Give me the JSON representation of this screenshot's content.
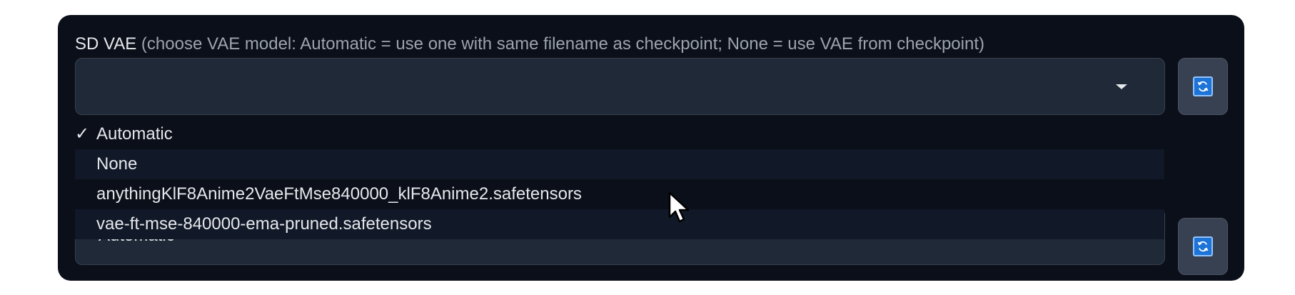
{
  "sd_vae": {
    "label_strong": "SD VAE",
    "label_note": "(choose VAE model: Automatic = use one with same filename as checkpoint; None = use VAE from checkpoint)",
    "value": ""
  },
  "second_select": {
    "value": "Automatic"
  },
  "dropdown": {
    "check_mark": "✓",
    "options": [
      {
        "label": "Automatic",
        "selected": true
      },
      {
        "label": "None",
        "selected": false
      },
      {
        "label": "anythingKlF8Anime2VaeFtMse840000_klF8Anime2.safetensors",
        "selected": false
      },
      {
        "label": "vae-ft-mse-840000-ema-pruned.safetensors",
        "selected": false
      }
    ]
  },
  "icons": {
    "dropdown_caret": "chevron-down-icon",
    "refresh": "refresh-icon",
    "cursor": "mouse-pointer-icon"
  },
  "colors": {
    "panel_bg": "#0b0f19",
    "input_bg": "#1f2937",
    "refresh_icon_bg": "#1d74d6",
    "text": "#e5e7eb",
    "muted_text": "#9ca3af"
  }
}
